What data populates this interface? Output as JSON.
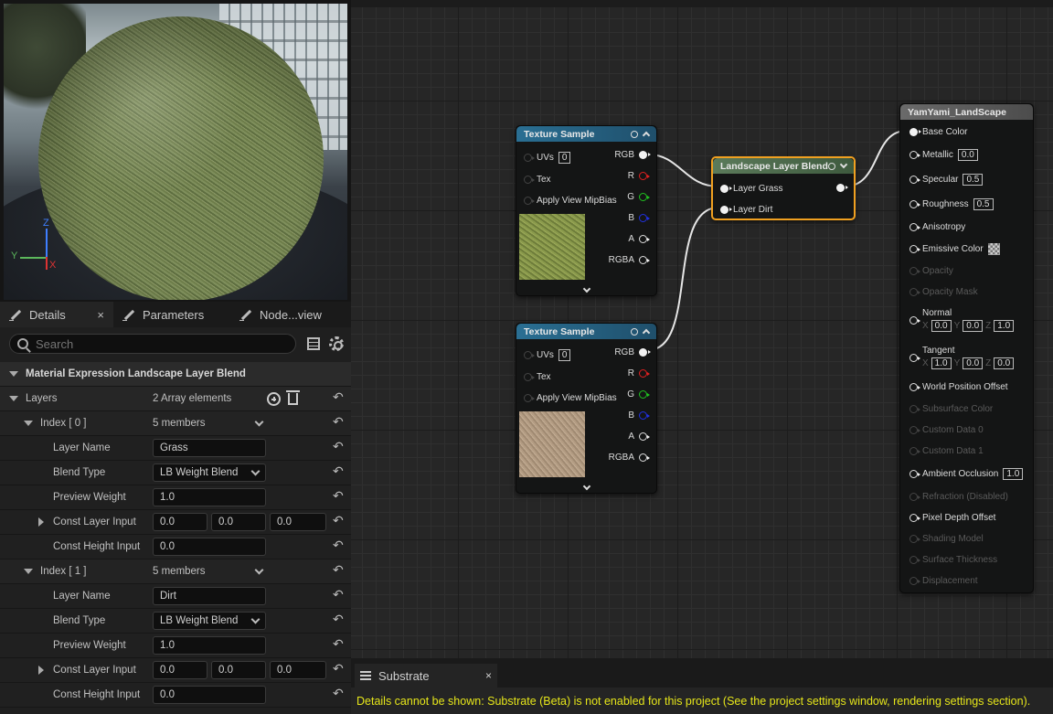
{
  "details_tabs": [
    {
      "label": "Details",
      "close": "×"
    },
    {
      "label": "Parameters"
    },
    {
      "label": "Node...view"
    }
  ],
  "search": {
    "placeholder": "Search"
  },
  "section_title": "Material Expression Landscape Layer Blend",
  "layers": {
    "label": "Layers",
    "count_text": "2 Array elements",
    "items": [
      {
        "index_label": "Index [ 0 ]",
        "members_text": "5 members",
        "layer_name_label": "Layer Name",
        "layer_name": "Grass",
        "blend_type_label": "Blend Type",
        "blend_type": "LB Weight Blend",
        "preview_weight_label": "Preview Weight",
        "preview_weight": "1.0",
        "const_layer_input_label": "Const Layer Input",
        "const_layer_input": [
          "0.0",
          "0.0",
          "0.0"
        ],
        "const_height_input_label": "Const Height Input",
        "const_height_input": "0.0"
      },
      {
        "index_label": "Index [ 1 ]",
        "members_text": "5 members",
        "layer_name_label": "Layer Name",
        "layer_name": "Dirt",
        "blend_type_label": "Blend Type",
        "blend_type": "LB Weight Blend",
        "preview_weight_label": "Preview Weight",
        "preview_weight": "1.0",
        "const_layer_input_label": "Const Layer Input",
        "const_layer_input": [
          "0.0",
          "0.0",
          "0.0"
        ],
        "const_height_input_label": "Const Height Input",
        "const_height_input": "0.0"
      }
    ]
  },
  "viewport": {
    "axis_z": "Z",
    "axis_y": "Y",
    "axis_x": "X"
  },
  "nodes": {
    "texture1": {
      "title": "Texture Sample",
      "inputs": [
        {
          "label": "UVs",
          "value": "0"
        },
        {
          "label": "Tex"
        },
        {
          "label": "Apply View MipBias"
        }
      ],
      "outputs": [
        "RGB",
        "R",
        "G",
        "B",
        "A",
        "RGBA"
      ]
    },
    "texture2": {
      "title": "Texture Sample",
      "inputs": [
        {
          "label": "UVs",
          "value": "0"
        },
        {
          "label": "Tex"
        },
        {
          "label": "Apply View MipBias"
        }
      ],
      "outputs": [
        "RGB",
        "R",
        "G",
        "B",
        "A",
        "RGBA"
      ]
    },
    "blend": {
      "title": "Landscape Layer Blend",
      "inputs": [
        "Layer Grass",
        "Layer Dirt"
      ]
    },
    "material": {
      "title": "YamYami_LandScape",
      "base_color": "Base Color",
      "metallic": {
        "label": "Metallic",
        "value": "0.0"
      },
      "specular": {
        "label": "Specular",
        "value": "0.5"
      },
      "roughness": {
        "label": "Roughness",
        "value": "0.5"
      },
      "anisotropy": "Anisotropy",
      "emissive": "Emissive Color",
      "opacity": "Opacity",
      "opacity_mask": "Opacity Mask",
      "normal": {
        "label": "Normal",
        "x_label": "X",
        "x": "0.0",
        "y_label": "Y",
        "y": "0.0",
        "z_label": "Z",
        "z": "1.0"
      },
      "tangent": {
        "label": "Tangent",
        "x_label": "X",
        "x": "1.0",
        "y_label": "Y",
        "y": "0.0",
        "z_label": "Z",
        "z": "0.0"
      },
      "wpo": "World Position Offset",
      "subsurface": "Subsurface Color",
      "custom0": "Custom Data 0",
      "custom1": "Custom Data 1",
      "ao": {
        "label": "Ambient Occlusion",
        "value": "1.0"
      },
      "refraction": "Refraction (Disabled)",
      "pdo": "Pixel Depth Offset",
      "shading_model": "Shading Model",
      "surface_thickness": "Surface Thickness",
      "displacement": "Displacement"
    }
  },
  "bottom": {
    "tab_label": "Substrate",
    "tab_close": "×",
    "message": "Details cannot be shown: Substrate (Beta) is not enabled for this project (See the project settings window, rendering settings section)."
  },
  "colors": {
    "accent_orange": "#f0a020",
    "warning_yellow": "#e6e61a",
    "texture_header": "#2a6f93"
  }
}
